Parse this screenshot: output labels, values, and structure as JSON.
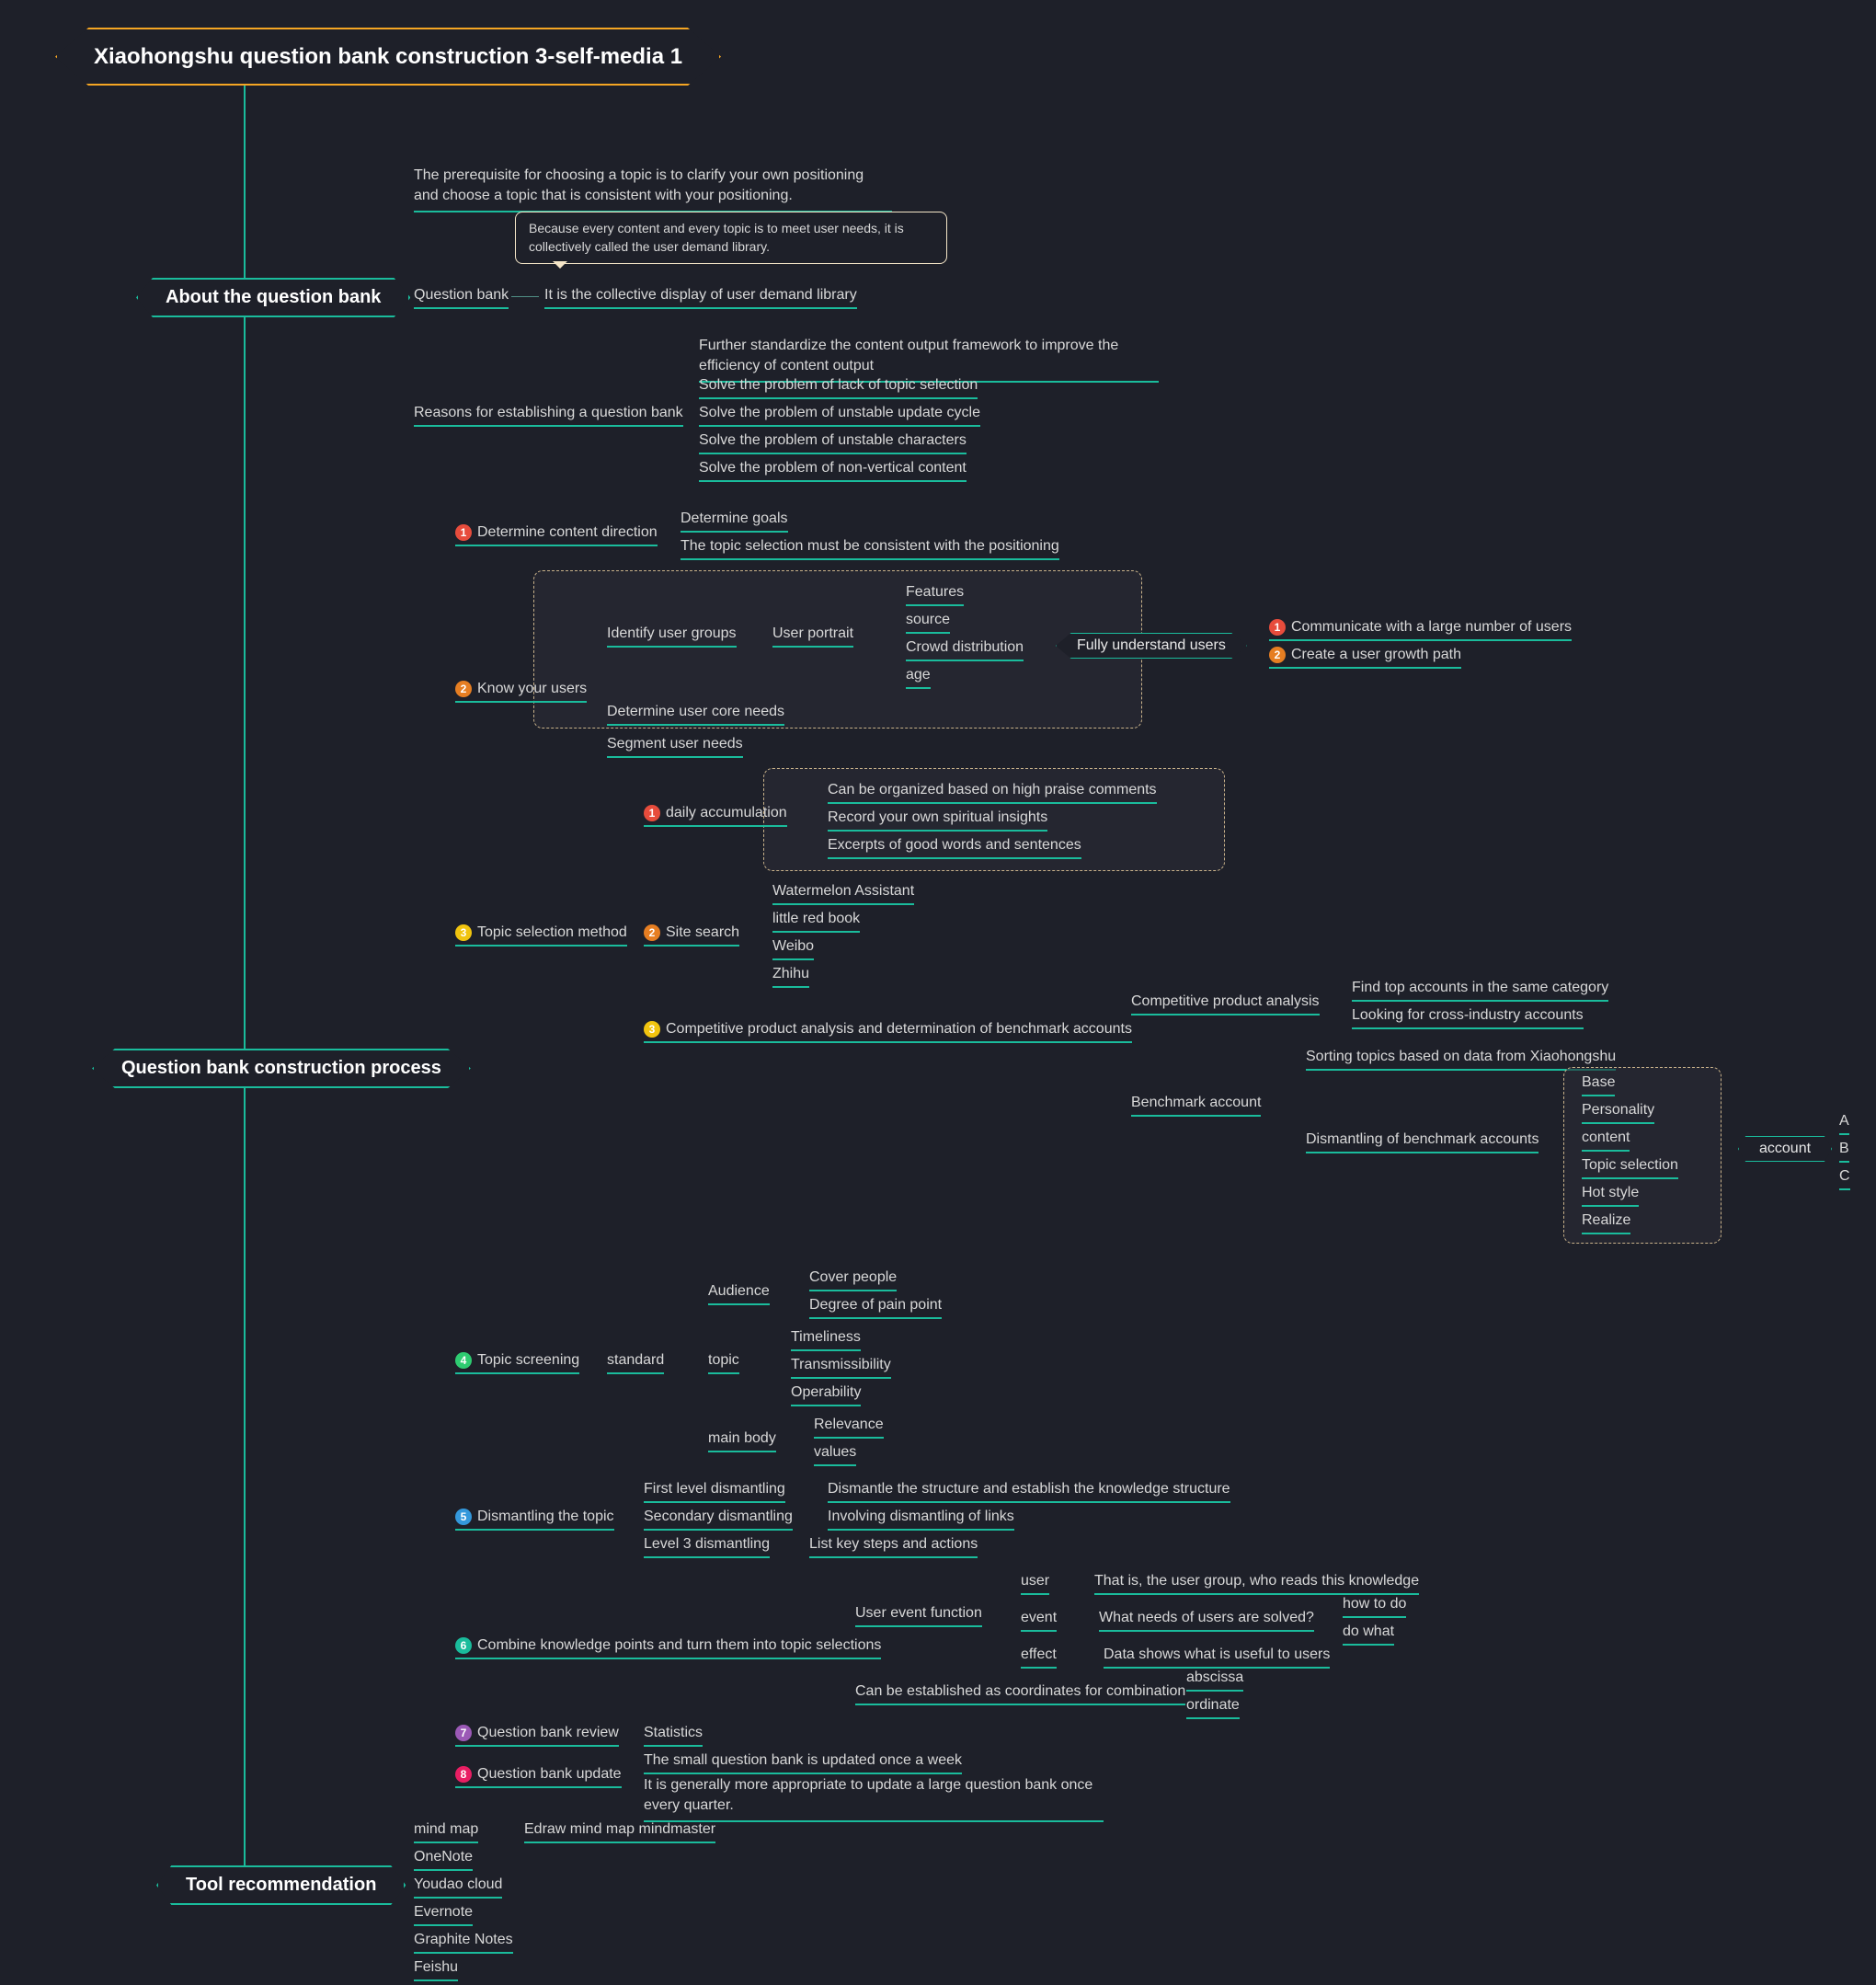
{
  "root": {
    "title": "Xiaohongshu question bank construction 3-self-media 1"
  },
  "callout": "Because every content and every topic is to meet user needs, it is collectively called the user demand library.",
  "branches": {
    "about": {
      "label": "About the question bank",
      "prereq": "The prerequisite for choosing a topic is to clarify your own positioning and choose a topic that is consistent with your positioning.",
      "qbank_label": "Question bank",
      "qbank_desc": "It is the collective display of user demand library",
      "reasons_label": "Reasons for establishing a question bank",
      "reasons": [
        "Further standardize the content output framework to improve the efficiency of content output",
        "Solve the problem of lack of topic selection",
        "Solve the problem of unstable update cycle",
        "Solve the problem of unstable characters",
        "Solve the problem of non-vertical content"
      ]
    },
    "process": {
      "label": "Question bank construction process",
      "s1": {
        "label": "Determine content direction",
        "items": [
          "Determine goals",
          "The topic selection must be consistent with the positioning"
        ]
      },
      "s2": {
        "label": "Know your users",
        "identify": "Identify user groups",
        "portrait": "User portrait",
        "portrait_items": [
          "Features",
          "source",
          "Crowd distribution",
          "age"
        ],
        "fully": "Fully understand users",
        "fully_items": [
          "Communicate with a large number of users",
          "Create a user growth path"
        ],
        "core": "Determine user core needs",
        "segment": "Segment user needs"
      },
      "s3": {
        "label": "Topic selection method",
        "daily": "daily accumulation",
        "daily_items": [
          "Can be organized based on high praise comments",
          "Record your own spiritual insights",
          "Excerpts of good words and sentences"
        ],
        "site": "Site search",
        "site_items": [
          "Watermelon Assistant",
          "little red book",
          "Weibo",
          "Zhihu"
        ],
        "comp": "Competitive product analysis and determination of benchmark accounts",
        "cpa_label": "Competitive product analysis",
        "cpa_items": [
          "Find top accounts in the same category",
          "Looking for cross-industry accounts"
        ],
        "bench": "Benchmark account",
        "bench_items": [
          "Sorting topics based on data from Xiaohongshu",
          "Dismantling of benchmark accounts"
        ],
        "dismantle_items": [
          "Base",
          "Personality",
          "content",
          "Topic selection",
          "Hot style",
          "Realize"
        ],
        "account": "account",
        "account_items": [
          "A",
          "B",
          "C"
        ]
      },
      "s4": {
        "label": "Topic screening",
        "standard": "standard",
        "aud": "Audience",
        "aud_items": [
          "Cover people",
          "Degree of pain point"
        ],
        "topic": "topic",
        "topic_items": [
          "Timeliness",
          "Transmissibility",
          "Operability"
        ],
        "main": "main body",
        "main_items": [
          "Relevance",
          "values"
        ]
      },
      "s5": {
        "label": "Dismantling the topic",
        "l1": "First level dismantling",
        "l1d": "Dismantle the structure and establish the knowledge structure",
        "l2": "Secondary dismantling",
        "l2d": "Involving dismantling of links",
        "l3": "Level 3 dismantling",
        "l3d": "List key steps and actions"
      },
      "s6": {
        "label": "Combine knowledge points and turn them into topic selections",
        "uef": "User event function",
        "user": "user",
        "user_d": "That is, the user group, who reads this knowledge",
        "event": "event",
        "event_d": "What needs of users are solved?",
        "event_items": [
          "how to do",
          "do what"
        ],
        "effect": "effect",
        "effect_d": "Data shows what is useful to users",
        "coords": "Can be established as coordinates for combination",
        "coords_items": [
          "abscissa",
          "ordinate"
        ]
      },
      "s7": {
        "label": "Question bank review",
        "stat": "Statistics"
      },
      "s8": {
        "label": "Question bank update",
        "items": [
          "The small question bank is updated once a week",
          "It is generally more appropriate to update a large question bank once every quarter."
        ]
      }
    },
    "tools": {
      "label": "Tool recommendation",
      "mindmap": "mind map",
      "mindmap_d": "Edraw mind map mindmaster",
      "items": [
        "OneNote",
        "Youdao cloud",
        "Evernote",
        "Graphite Notes",
        "Feishu"
      ]
    }
  }
}
